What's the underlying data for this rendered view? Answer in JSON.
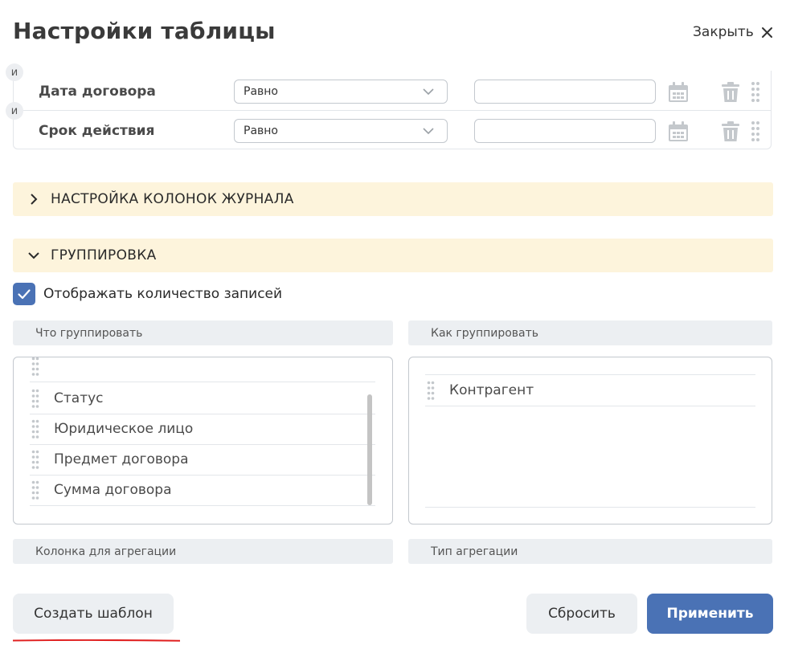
{
  "header": {
    "title": "Настройки таблицы",
    "close_label": "Закрыть"
  },
  "filters": {
    "rows": [
      {
        "connector": "и",
        "field": "Дата договора",
        "operator": "Равно",
        "value": ""
      },
      {
        "connector": "и",
        "field": "Срок действия",
        "operator": "Равно",
        "value": ""
      }
    ]
  },
  "sections": {
    "columns": {
      "label": "НАСТРОЙКА КОЛОНОК ЖУРНАЛА",
      "expanded": false
    },
    "grouping": {
      "label": "ГРУППИРОВКА",
      "expanded": true
    }
  },
  "grouping": {
    "show_count_label": "Отображать количество записей",
    "show_count_checked": true,
    "what_header": "Что группировать",
    "how_header": "Как группировать",
    "what_items": [
      "Статус",
      "Юридическое лицо",
      "Предмет договора",
      "Сумма договора"
    ],
    "how_items": [
      "Контрагент"
    ],
    "agg_column_header": "Колонка для агрегации",
    "agg_type_header": "Тип агрегации"
  },
  "footer": {
    "create_template": "Создать шаблон",
    "reset": "Сбросить",
    "apply": "Применить"
  },
  "colors": {
    "accent": "#4a72b5",
    "section_bg": "#fdf4dc",
    "header_bg": "#eceff2",
    "annotation": "#e02020"
  }
}
